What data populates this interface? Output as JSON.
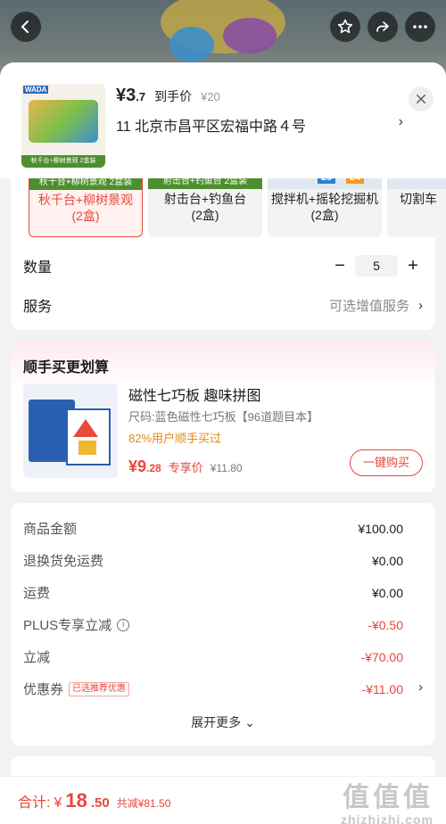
{
  "header": {
    "price_whole": "3",
    "price_decimal": ".7",
    "price_label": "到手价",
    "original_price": "¥20",
    "address": "11  北京市昌平区宏福中路４号",
    "address_arrow": "›",
    "thumb_brand": "WADA",
    "thumb_caption": "秋千台+柳树景观  2盒装"
  },
  "variants": [
    {
      "tag": "秋千台+柳树景观  2盒装",
      "name": "秋千台+柳树景观\n(2盒)",
      "selected": true
    },
    {
      "tag": "射击台+钓鱼台  2盒装",
      "name": "射击台+钓鱼台\n(2盒)",
      "selected": false
    },
    {
      "badge1": "25",
      "badge2": "24",
      "name": "搅拌机+摇轮挖掘机\n(2盒)",
      "selected": false
    },
    {
      "name": "切割车",
      "selected": false
    }
  ],
  "quantity": {
    "label": "数量",
    "minus": "−",
    "value": "5",
    "plus": "+"
  },
  "service": {
    "label": "服务",
    "value": "可选增值服务",
    "arrow": "›"
  },
  "bundle": {
    "title": "顺手买更划算",
    "name": "磁性七巧板 趣味拼图",
    "size": "尺码:蓝色磁性七巧板【96道题目本】",
    "percent": "82%用户顺手买过",
    "price_whole": "9",
    "price_decimal": ".28",
    "price_label": "专享价",
    "original_price": "¥11.80",
    "buy_button": "一键购买"
  },
  "summary": {
    "rows": [
      {
        "label": "商品金额",
        "value": "¥100.00",
        "red": false
      },
      {
        "label": "退换货免运费",
        "value": "¥0.00",
        "red": false
      },
      {
        "label": "运费",
        "value": "¥0.00",
        "red": false
      },
      {
        "label": "PLUS专享立减",
        "value": "-¥0.50",
        "red": true
      },
      {
        "label": "立减",
        "value": "-¥70.00",
        "red": true
      },
      {
        "label": "优惠券",
        "value": "-¥11.00",
        "red": true
      }
    ],
    "info_icon": "i",
    "coupon_tag": "已选推荐优惠",
    "more": "展开更多 ⌄"
  },
  "footer": {
    "total_label": "合计:",
    "total_currency": "¥",
    "total_whole": "18",
    "total_decimal": ".50",
    "saved": "共减¥81.50",
    "watermark_big": "值值值",
    "watermark_small": "zhizhizhi.com"
  },
  "colors": {
    "accent": "#e8473b",
    "orange": "#e38a15",
    "green_tag": "#4d8f2e"
  }
}
